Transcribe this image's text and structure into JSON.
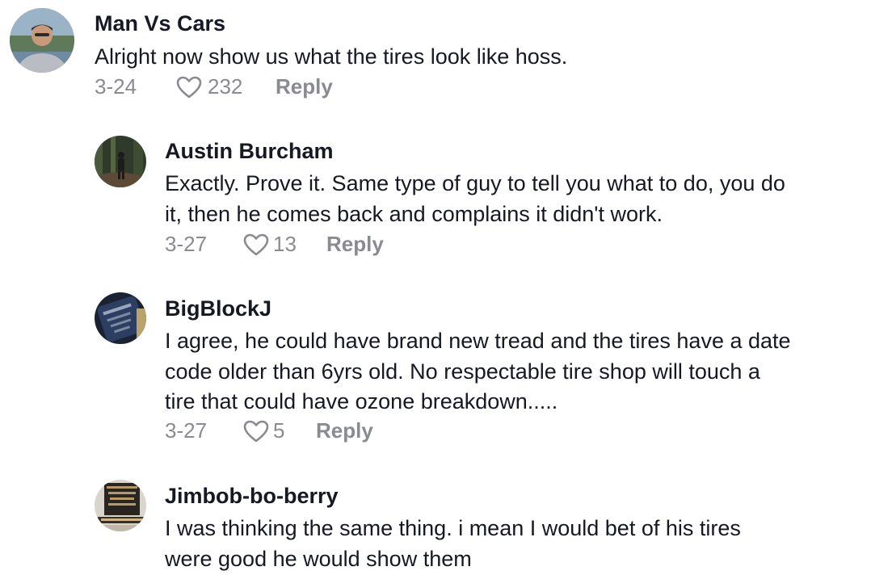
{
  "comments": [
    {
      "username": "Man Vs Cars",
      "text_lines": [
        "Alright now show us what the tires look like hoss."
      ],
      "date": "3-24",
      "likes": "232",
      "reply_label": "Reply",
      "avatar_icon": "avatar-photo-man"
    },
    {
      "username": "Austin Burcham",
      "text_lines": [
        "Exactly. Prove it. Same type of guy to tell you what to do, you do",
        "it, then he comes back and complains it didn't work."
      ],
      "date": "3-27",
      "likes": "13",
      "reply_label": "Reply",
      "avatar_icon": "avatar-photo-forest"
    },
    {
      "username": "BigBlockJ",
      "text_lines": [
        "I agree, he could have brand new tread and the tires have a date",
        "code older than 6yrs old. No respectable tire shop will touch a",
        "tire that could have ozone breakdown....."
      ],
      "date": "3-27",
      "likes": "5",
      "reply_label": "Reply",
      "avatar_icon": "avatar-photo-badge"
    },
    {
      "username": "Jimbob-bo-berry",
      "text_lines": [
        "I was thinking the same thing. i mean I would bet of his tires",
        "were good he would show them"
      ],
      "avatar_icon": "avatar-photo-bake-shop"
    }
  ],
  "colors": {
    "text": "#161823",
    "muted": "#8a8b91",
    "background": "#ffffff"
  }
}
